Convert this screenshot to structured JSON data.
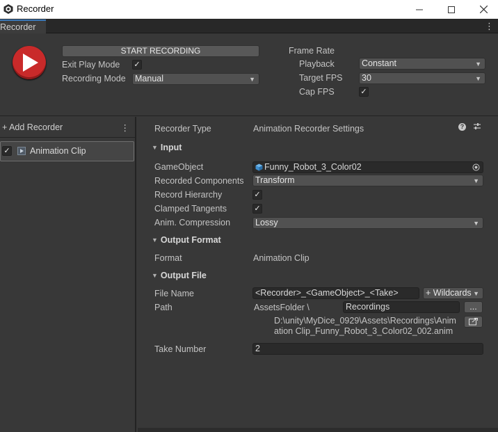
{
  "window": {
    "title": "Recorder"
  },
  "tab": {
    "label": "Recorder"
  },
  "top": {
    "start_label": "START RECORDING",
    "exit_play_mode_label": "Exit Play Mode",
    "recording_mode_label": "Recording Mode",
    "recording_mode_value": "Manual",
    "frame_rate_label": "Frame Rate",
    "playback_label": "Playback",
    "playback_value": "Constant",
    "target_fps_label": "Target FPS",
    "target_fps_value": "30",
    "cap_fps_label": "Cap FPS",
    "exit_play_mode_checked": true,
    "cap_fps_checked": true
  },
  "left": {
    "add_recorder_label": "+ Add Recorder",
    "recorders": [
      {
        "label": "Animation Clip",
        "enabled": true
      }
    ]
  },
  "right": {
    "recorder_type_label": "Recorder Type",
    "recorder_type_value": "Animation Recorder Settings",
    "input_section": "Input",
    "gameobject_label": "GameObject",
    "gameobject_value": "Funny_Robot_3_Color02",
    "recorded_components_label": "Recorded Components",
    "recorded_components_value": "Transform",
    "record_hierarchy_label": "Record Hierarchy",
    "clamped_tangents_label": "Clamped Tangents",
    "anim_compression_label": "Anim. Compression",
    "anim_compression_value": "Lossy",
    "output_format_section": "Output Format",
    "format_label": "Format",
    "format_value": "Animation Clip",
    "output_file_section": "Output File",
    "file_name_label": "File Name",
    "file_name_value": "<Recorder>_<GameObject>_<Take>",
    "wildcards_label": "+ Wildcards",
    "path_label": "Path",
    "path_root": "AssetsFolder \\",
    "path_folder": "Recordings",
    "browse_label": "...",
    "full_path_line1": "D:\\unity\\MyDice_0929\\Assets\\Recordings\\Anim",
    "full_path_line2": "ation Clip_Funny_Robot_3_Color02_002.anim",
    "take_number_label": "Take Number",
    "take_number_value": "2"
  },
  "icons": {
    "play": "play-icon",
    "help": "help-icon",
    "preset": "preset-sliders-icon",
    "gameobject": "gameobject-cube-icon",
    "target": "object-picker-icon",
    "open_folder": "open-folder-icon",
    "kebab": "kebab-menu-icon"
  },
  "colors": {
    "accent_tab": "#3a79bb",
    "play_red": "#c92a2a",
    "panel_bg": "#383838"
  }
}
